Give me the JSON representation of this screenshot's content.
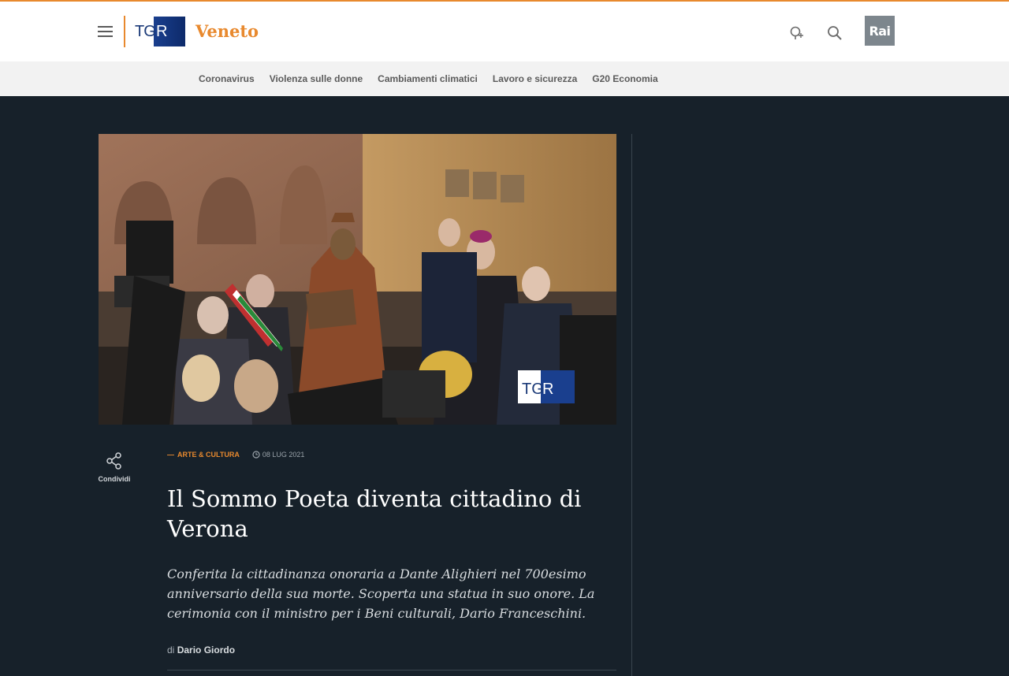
{
  "header": {
    "menu_icon": "hamburger-menu-icon",
    "logo_text_left": "TG",
    "logo_text_right": "R",
    "region": "Veneto",
    "weather_icon": "weather-icon",
    "search_icon": "search-icon",
    "rai_logo": "Rai"
  },
  "subnav": {
    "items": [
      {
        "label": "Coronavirus"
      },
      {
        "label": "Violenza sulle donne"
      },
      {
        "label": "Cambiamenti climatici"
      },
      {
        "label": "Lavoro e sicurezza"
      },
      {
        "label": "G20 Economia"
      }
    ]
  },
  "article": {
    "image_watermark_left": "TG",
    "image_watermark_right": "R",
    "share_label": "Condividi",
    "category_dash": "—",
    "category": "ARTE & CULTURA",
    "date": "08 LUG 2021",
    "title": "Il Sommo Poeta diventa cittadino di Verona",
    "lead": "Conferita la cittadinanza onoraria a Dante Alighieri nel 700esimo anniversario della sua morte. Scoperta una statua in suo onore. La cerimonia con il ministro per i Beni culturali, Dario Franceschini.",
    "byline_prefix": "di",
    "author": "Dario Giordo"
  },
  "colors": {
    "accent": "#e8892e",
    "background": "#17212a",
    "header_bg": "#ffffff",
    "subnav_bg": "#f2f2f2"
  }
}
